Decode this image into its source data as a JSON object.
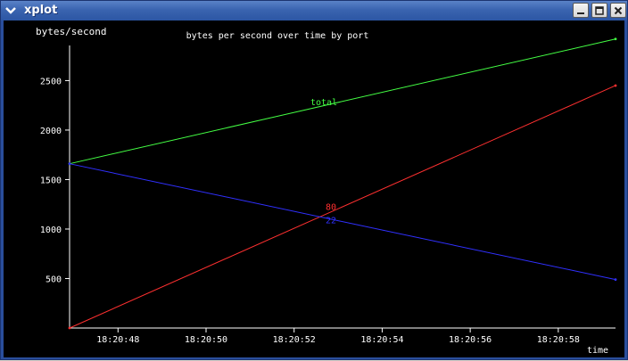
{
  "window": {
    "title": "xplot",
    "icons": {
      "menu": "chevron-down-icon",
      "minimize": "minimize-icon",
      "maximize": "maximize-icon",
      "close": "close-icon"
    }
  },
  "chart_data": {
    "type": "line",
    "title": "bytes per second over time by port",
    "ylabel": "bytes/second",
    "xlabel": "time",
    "x_range": [
      "18:20:46.9",
      "18:20:59.3"
    ],
    "ylim": [
      0,
      2900
    ],
    "x_ticks": [
      "18:20:48",
      "18:20:50",
      "18:20:52",
      "18:20:54",
      "18:20:56",
      "18:20:58"
    ],
    "y_ticks": [
      500,
      1000,
      1500,
      2000,
      2500
    ],
    "grid": false,
    "background": "#000000",
    "series": [
      {
        "name": "total",
        "color": "#44ff44",
        "x": [
          "18:20:46.9",
          "18:20:59.3"
        ],
        "values": [
          1660,
          2920
        ]
      },
      {
        "name": "80",
        "color": "#ff3030",
        "x": [
          "18:20:46.9",
          "18:20:59.3"
        ],
        "values": [
          0,
          2450
        ]
      },
      {
        "name": "22",
        "color": "#3030ff",
        "x": [
          "18:20:46.9",
          "18:20:59.3"
        ],
        "values": [
          1660,
          490
        ]
      }
    ]
  }
}
